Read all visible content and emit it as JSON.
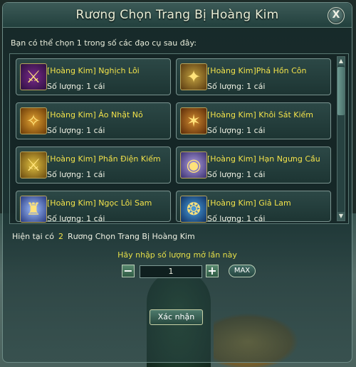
{
  "dialog": {
    "title": "Rương Chọn Trang Bị Hoàng Kim",
    "close_label": "X",
    "instruction": "Bạn có thể chọn 1 trong số các đạo cụ sau đây:"
  },
  "items": [
    {
      "name": "[Hoàng Kim] Nghịch Lôi",
      "qty": "Số lượng: 1 cái",
      "icon": "sword-icon"
    },
    {
      "name": "[Hoàng Kim]Phá Hồn Côn",
      "qty": "Số lượng: 1 cái",
      "icon": "staff-icon"
    },
    {
      "name": "[Hoàng Kim] Ảo Nhật Nỏ",
      "qty": "Số lượng: 1 cái",
      "icon": "crossbow-icon"
    },
    {
      "name": "[Hoàng Kim] Khôi Sát Kiếm",
      "qty": "Số lượng: 1 cái",
      "icon": "blade-icon"
    },
    {
      "name": "[Hoàng Kim] Phần Điện Kiếm",
      "qty": "Số lượng: 1 cái",
      "icon": "sword-icon"
    },
    {
      "name": "[Hoàng Kim] Hạn Ngưng Cầu",
      "qty": "Số lượng: 1 cái",
      "icon": "orb-icon"
    },
    {
      "name": "[Hoàng Kim] Ngọc Lôi Sam",
      "qty": "Số lượng: 1 cái",
      "icon": "robe-icon"
    },
    {
      "name": "[Hoàng Kim] Giả Lam",
      "qty": "Số lượng: 1 cái",
      "icon": "amulet-icon"
    }
  ],
  "status": {
    "prefix": "Hiện tại có",
    "count": "2",
    "suffix": "Rương Chọn Trang Bị Hoàng Kim"
  },
  "quantity": {
    "prompt": "Hãy nhập số lượng mở lần này",
    "minus_label": "−",
    "plus_label": "+",
    "value": "1",
    "max_label": "MAX"
  },
  "confirm_label": "Xác nhận"
}
